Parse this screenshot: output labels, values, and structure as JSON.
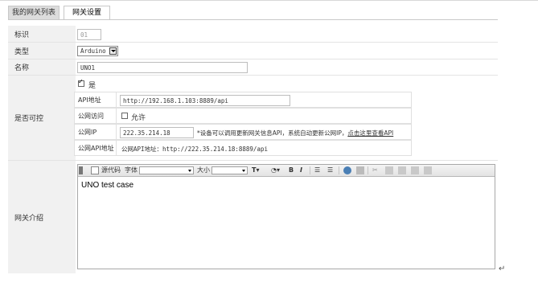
{
  "tabs": [
    {
      "label": "我的网关列表"
    },
    {
      "label": "网关设置"
    }
  ],
  "fields": {
    "id_label": "标识",
    "id_value": "01",
    "type_label": "类型",
    "type_value": "Arduino",
    "name_label": "名称",
    "name_value": "UNO1",
    "control_label": "是否可控",
    "control_checkbox_label": "是",
    "intro_label": "网关介绍"
  },
  "control_settings": {
    "api_label": "API地址",
    "api_value": "http://192.168.1.103:8889/api",
    "public_access_label": "公网访问",
    "public_access_checkbox_label": "允许",
    "public_ip_label": "公网IP",
    "public_ip_value": "222.35.214.18",
    "public_ip_hint": "*设备可以调用更新网关信息API，系统自动更新公网IP，",
    "public_ip_link": "点击这里查看API",
    "public_api_label": "公网API地址",
    "public_api_value": "公网API地址：http://222.35.214.18:8889/api"
  },
  "editor": {
    "source_label": "源代码",
    "font_label": "字体",
    "size_label": "大小",
    "content": "UNO test case"
  },
  "misc": {
    "return_mark": "↵"
  }
}
